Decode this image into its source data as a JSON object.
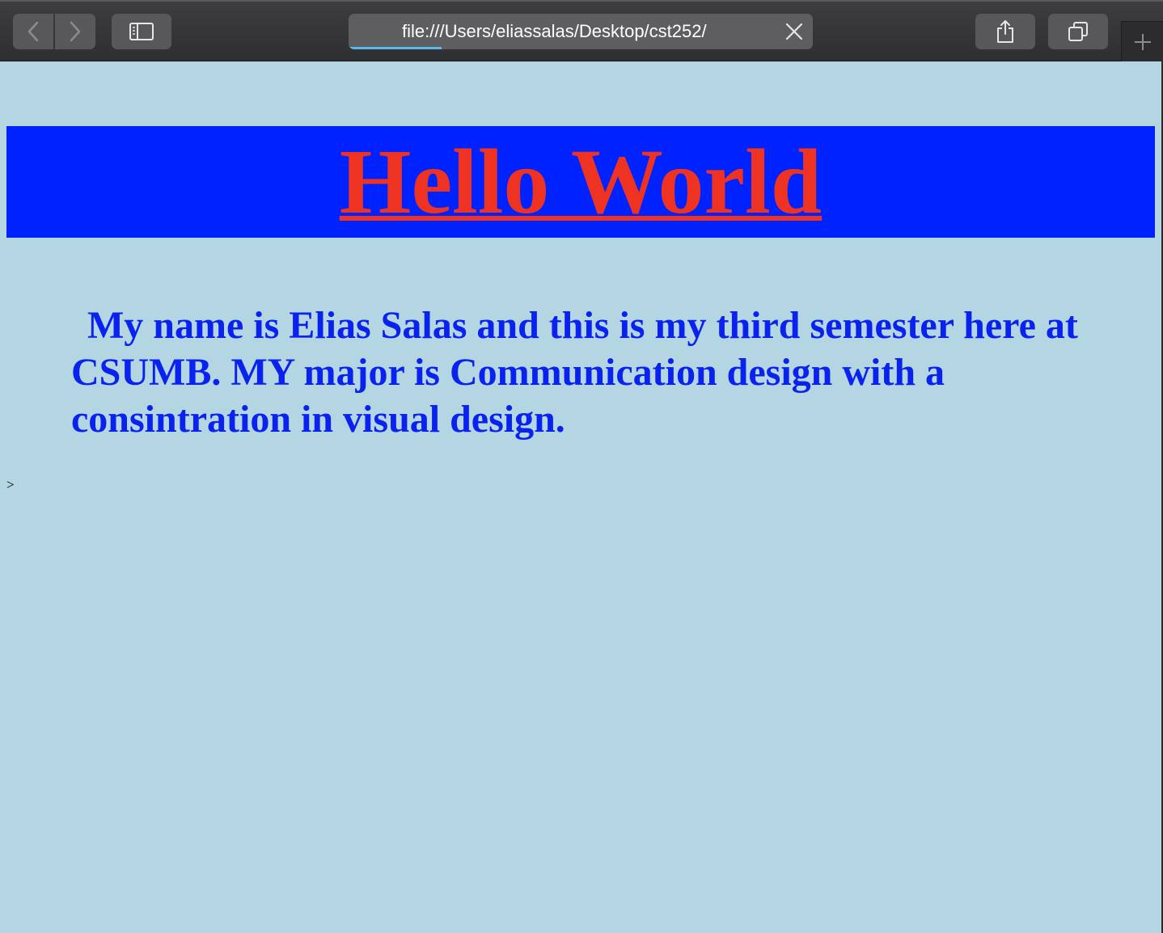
{
  "browser": {
    "address_bar": {
      "url": "file:///Users/eliassalas/Desktop/cst252/",
      "loading_progress": 0.2
    },
    "icons": {
      "back": "chevron-left-icon",
      "forward": "chevron-right-icon",
      "sidebar": "sidebar-icon",
      "stop": "close-icon",
      "share": "share-icon",
      "tabs": "tabs-overview-icon",
      "new_tab": "plus-icon"
    }
  },
  "page": {
    "background_color": "#b3d6e2",
    "heading": {
      "text": "Hello World",
      "text_color": "#ee3322",
      "band_color": "#0022ff"
    },
    "intro": {
      "text": "My name is Elias Salas and this is my third semester here at CSUMB. MY major is Communication design with a consintration in visual design.",
      "text_color": "#0a22ee"
    },
    "stray_text": ">"
  }
}
